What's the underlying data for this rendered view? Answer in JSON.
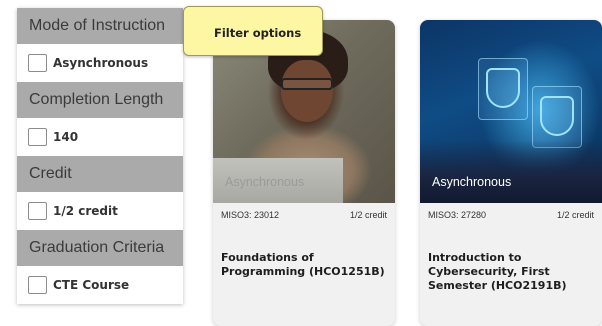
{
  "tooltip": {
    "text": "Filter options"
  },
  "filters": [
    {
      "header": "Mode of Instruction",
      "option": "Asynchronous"
    },
    {
      "header": "Completion Length",
      "option": "140"
    },
    {
      "header": "Credit",
      "option": "1/2 credit"
    },
    {
      "header": "Graduation Criteria",
      "option": "CTE Course"
    }
  ],
  "courses": [
    {
      "image_caption": "Asynchronous",
      "code": "MISO3: 23012",
      "credit": "1/2 credit",
      "title": "Foundations of Programming (HCO1251B)"
    },
    {
      "image_caption": "Asynchronous",
      "code": "MISO3: 27280",
      "credit": "1/2 credit",
      "title": "Introduction to Cybersecurity, First Semester (HCO2191B)"
    }
  ]
}
